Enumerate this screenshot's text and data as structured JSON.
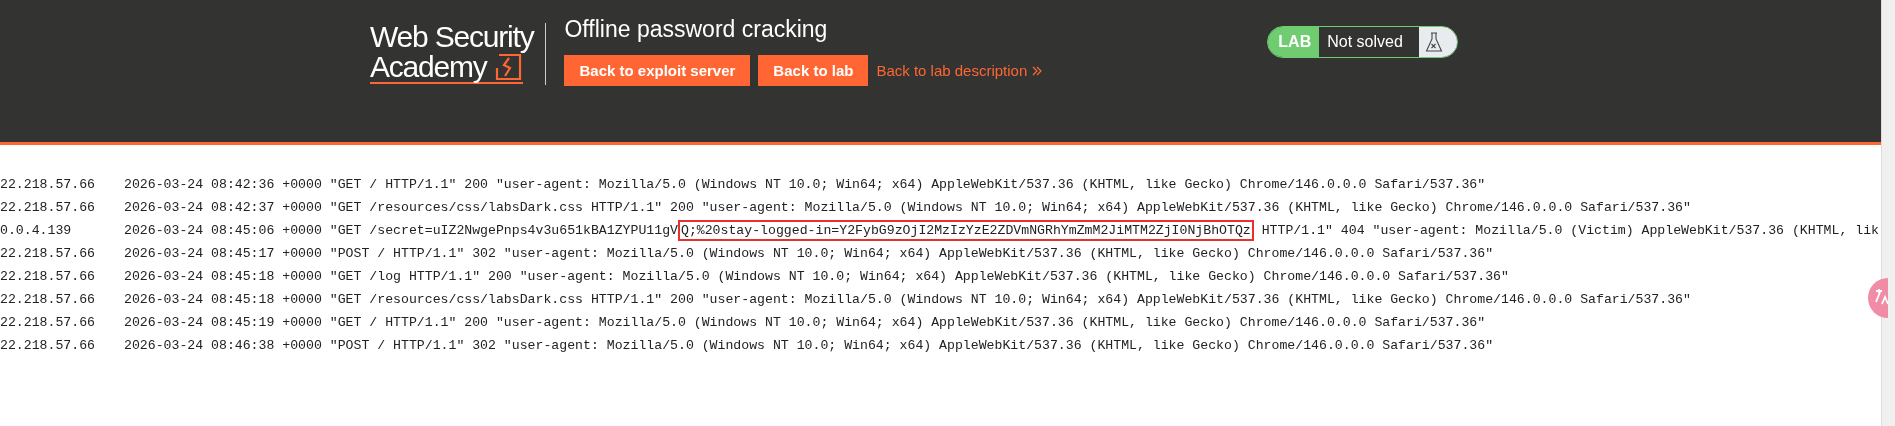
{
  "header": {
    "logo": {
      "line1": "Web Security",
      "line2": "Academy"
    },
    "title": "Offline password cracking",
    "actions": [
      {
        "label": "Back to exploit server",
        "kind": "button"
      },
      {
        "label": "Back to lab",
        "kind": "button"
      },
      {
        "label": "Back to lab description",
        "kind": "link"
      }
    ],
    "lab_status": {
      "badge": "LAB",
      "status": "Not solved"
    }
  },
  "log": [
    {
      "ip": "22.218.57.66",
      "parts": [
        {
          "text": "2026-03-24 08:42:36 +0000 \"GET / HTTP/1.1\" 200 \"user-agent: Mozilla/5.0 (Windows NT 10.0; Win64; x64) AppleWebKit/537.36 (KHTML, like Gecko) Chrome/146.0.0.0 Safari/537.36\"",
          "highlighted": false
        }
      ]
    },
    {
      "ip": "22.218.57.66",
      "parts": [
        {
          "text": "2026-03-24 08:42:37 +0000 \"GET /resources/css/labsDark.css HTTP/1.1\" 200 \"user-agent: Mozilla/5.0 (Windows NT 10.0; Win64; x64) AppleWebKit/537.36 (KHTML, like Gecko) Chrome/146.0.0.0 Safari/537.36\"",
          "highlighted": false
        }
      ]
    },
    {
      "ip": "0.0.4.139",
      "parts": [
        {
          "text": "2026-03-24 08:45:06 +0000 \"GET /secret=uIZ2NwgePnps4v3u651kBA1ZYPU11gV",
          "highlighted": false
        },
        {
          "text": "Q;%20stay-logged-in=Y2FybG9zOjI2MzIzYzE2ZDVmNGRhYmZmM2JiMTM2ZjI0NjBhOTQz",
          "highlighted": true
        },
        {
          "text": " HTTP/1.1\" 404 \"user-agent: Mozilla/5.0 (Victim) AppleWebKit/537.36 (KHTML, lik",
          "highlighted": false
        }
      ]
    },
    {
      "ip": "22.218.57.66",
      "parts": [
        {
          "text": "2026-03-24 08:45:17 +0000 \"POST / HTTP/1.1\" 302 \"user-agent: Mozilla/5.0 (Windows NT 10.0; Win64; x64) AppleWebKit/537.36 (KHTML, like Gecko) Chrome/146.0.0.0 Safari/537.36\"",
          "highlighted": false
        }
      ]
    },
    {
      "ip": "22.218.57.66",
      "parts": [
        {
          "text": "2026-03-24 08:45:18 +0000 \"GET /log HTTP/1.1\" 200 \"user-agent: Mozilla/5.0 (Windows NT 10.0; Win64; x64) AppleWebKit/537.36 (KHTML, like Gecko) Chrome/146.0.0.0 Safari/537.36\"",
          "highlighted": false
        }
      ]
    },
    {
      "ip": "22.218.57.66",
      "parts": [
        {
          "text": "2026-03-24 08:45:18 +0000 \"GET /resources/css/labsDark.css HTTP/1.1\" 200 \"user-agent: Mozilla/5.0 (Windows NT 10.0; Win64; x64) AppleWebKit/537.36 (KHTML, like Gecko) Chrome/146.0.0.0 Safari/537.36\"",
          "highlighted": false
        }
      ]
    },
    {
      "ip": "22.218.57.66",
      "parts": [
        {
          "text": "2026-03-24 08:45:19 +0000 \"GET / HTTP/1.1\" 200 \"user-agent: Mozilla/5.0 (Windows NT 10.0; Win64; x64) AppleWebKit/537.36 (KHTML, like Gecko) Chrome/146.0.0.0 Safari/537.36\"",
          "highlighted": false
        }
      ]
    },
    {
      "ip": "22.218.57.66",
      "parts": [
        {
          "text": "2026-03-24 08:46:38 +0000 \"POST / HTTP/1.1\" 302 \"user-agent: Mozilla/5.0 (Windows NT 10.0; Win64; x64) AppleWebKit/537.36 (KHTML, like Gecko) Chrome/146.0.0.0 Safari/537.36\"",
          "highlighted": false
        }
      ]
    }
  ]
}
